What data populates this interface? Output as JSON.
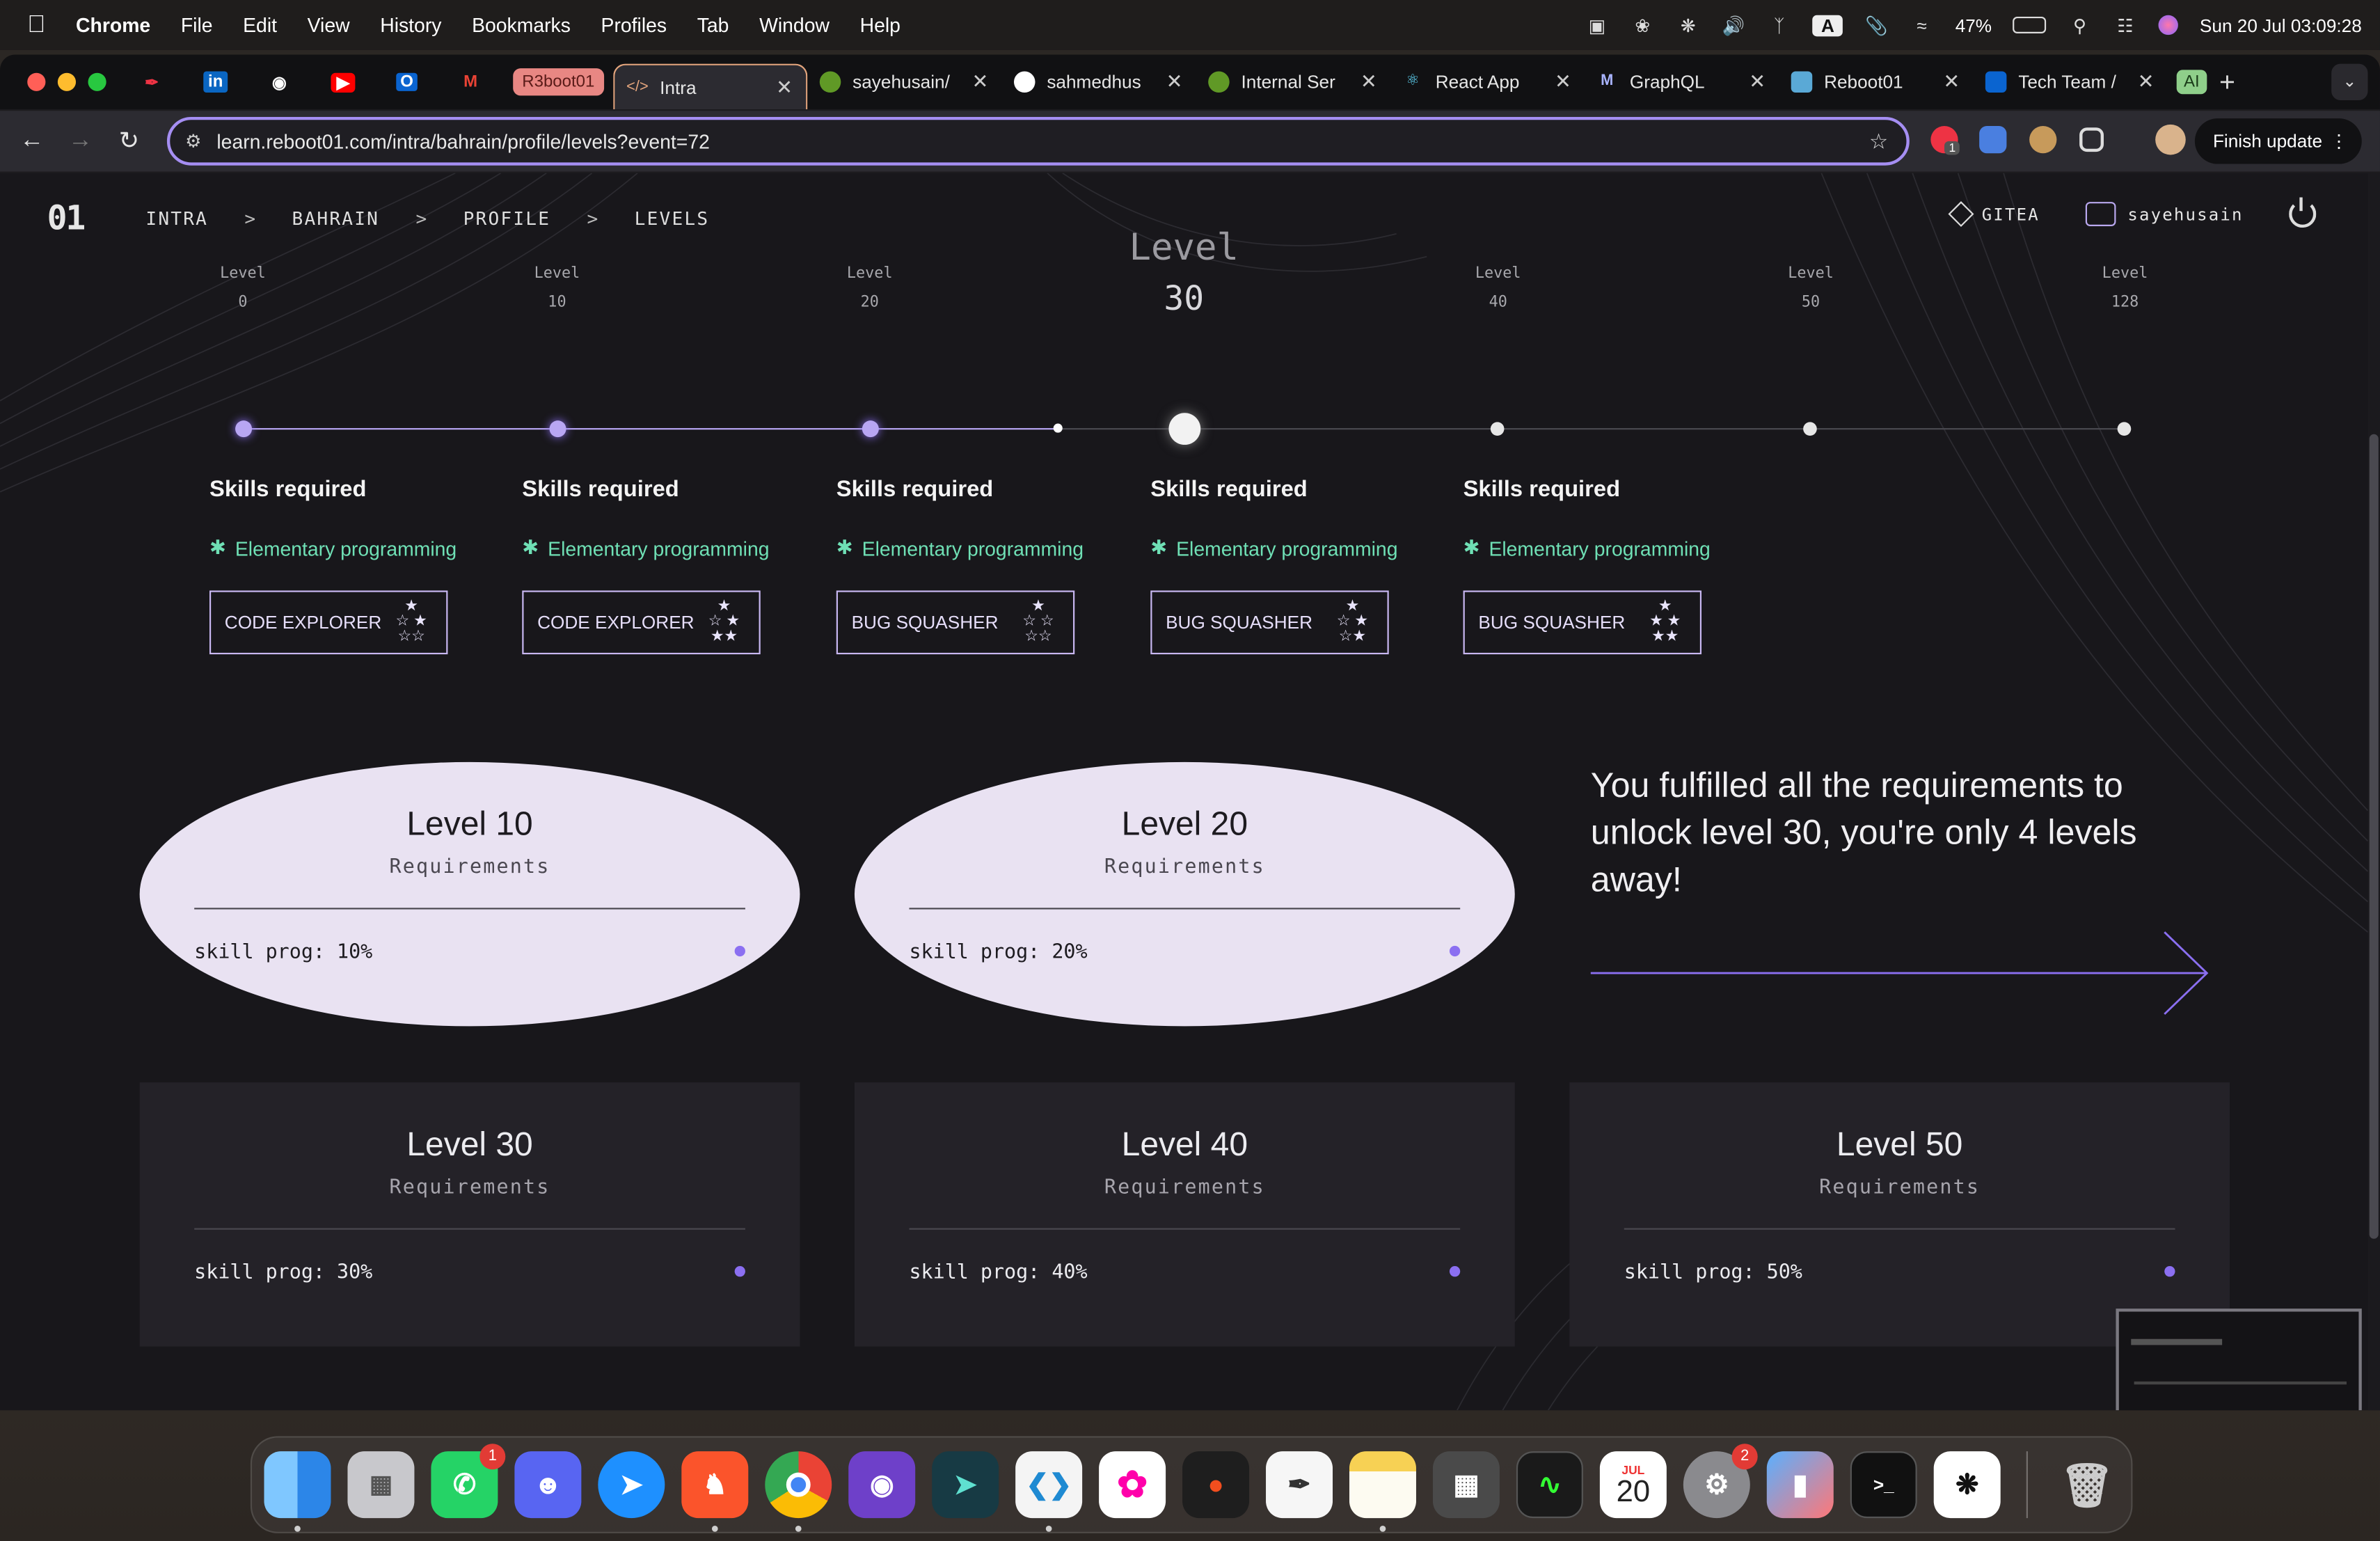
{
  "menubar": {
    "app": "Chrome",
    "items": [
      "File",
      "Edit",
      "View",
      "History",
      "Bookmarks",
      "Profiles",
      "Tab",
      "Window",
      "Help"
    ],
    "battery": "47%",
    "datetime": "Sun 20 Jul  03:09:28",
    "input_source": "A"
  },
  "tabs": {
    "group_chip": "R3boot01",
    "items": [
      {
        "label": "Intra",
        "icon": "code-icon",
        "active": true
      },
      {
        "label": "sayehusain/",
        "icon": "gitea-icon"
      },
      {
        "label": "sahmedhus",
        "icon": "github-icon"
      },
      {
        "label": "Internal Ser",
        "icon": "gitea-icon"
      },
      {
        "label": "React App",
        "icon": "react-icon"
      },
      {
        "label": "GraphQL",
        "icon": "graphql-icon"
      },
      {
        "label": "Reboot01",
        "icon": "reboot-icon"
      },
      {
        "label": "Tech Team /",
        "icon": "outlook-icon"
      }
    ],
    "ai_chip": "AI",
    "new_tab": "+"
  },
  "toolbar": {
    "url": "learn.reboot01.com/intra/bahrain/profile/levels?event=72",
    "finish_update": "Finish update",
    "ext_badge": "1"
  },
  "site": {
    "logo": "01",
    "breadcrumbs": [
      "INTRA",
      "BAHRAIN",
      "PROFILE",
      "LEVELS"
    ],
    "separator": ">",
    "gitea": "GITEA",
    "user": "sayehusain"
  },
  "timeline": {
    "label": "Level",
    "levels": [
      "0",
      "10",
      "20",
      "40",
      "50",
      "128"
    ],
    "current": "30"
  },
  "skills": {
    "title": "Skills required",
    "columns": [
      {
        "skill": "Elementary programming",
        "badge": "CODE EXPLORER"
      },
      {
        "skill": "Elementary programming",
        "badge": "CODE EXPLORER"
      },
      {
        "skill": "Elementary programming",
        "badge": "BUG SQUASHER"
      },
      {
        "skill": "Elementary programming",
        "badge": "BUG SQUASHER"
      },
      {
        "skill": "Elementary programming",
        "badge": "BUG SQUASHER"
      }
    ]
  },
  "cards": [
    {
      "title": "Level 10",
      "subtitle": "Requirements",
      "row": "skill prog: 10%"
    },
    {
      "title": "Level 20",
      "subtitle": "Requirements",
      "row": "skill prog: 20%"
    },
    {
      "title": "Level 30",
      "subtitle": "Requirements",
      "row": "skill prog: 30%"
    },
    {
      "title": "Level 40",
      "subtitle": "Requirements",
      "row": "skill prog: 40%"
    },
    {
      "title": "Level 50",
      "subtitle": "Requirements",
      "row": "skill prog: 50%"
    }
  ],
  "message": "You fulfilled all the requirements to unlock level 30, you're only 4 levels away!",
  "dock": {
    "apps": [
      "Finder",
      "Launchpad",
      "WhatsApp",
      "Discord",
      "Safari",
      "Brave",
      "Chrome",
      "GitHub Desktop",
      "Prompt",
      "VS Code",
      "Photos",
      "Figma",
      "Freeform",
      "Notes",
      "Calculator",
      "Activity Monitor",
      "Calendar",
      "System Settings",
      "Simulator",
      "Terminal",
      "ChatGPT",
      "Trash"
    ],
    "whatsapp_badge": "1",
    "settings_badge": "2",
    "calendar_month": "JUL",
    "calendar_day": "20"
  },
  "colors": {
    "accent": "#8b6ff1",
    "skill_green": "#6fe0b5",
    "card_light": "#e9e2f2",
    "card_dark": "#242228",
    "omnibox_border": "#a58ef2"
  }
}
